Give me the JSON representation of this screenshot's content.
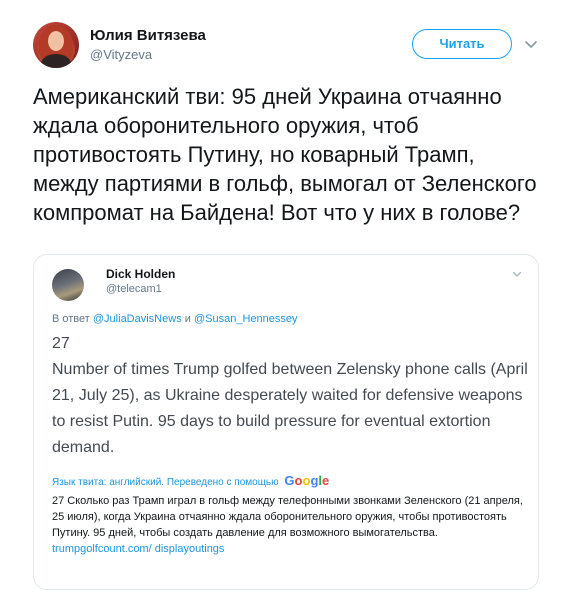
{
  "author": {
    "name": "Юлия Витязева",
    "handle": "@Vityzeva"
  },
  "follow_button": {
    "label": "Читать"
  },
  "icons": {
    "menu": "chevron-down-icon"
  },
  "tweet": {
    "text": "Американский тви: 95 дней Украина отчаянно ждала оборонительного оружия, чтоб противостоять Путину, но коварный Трамп, между партиями в гольф, вымогал от Зеленского компромат на Байдена! Вот что у них в голове?"
  },
  "quoted_tweet": {
    "name": "Dick Holden",
    "handle": "@telecam1",
    "reply_prefix": "В ответ",
    "reply_user_1": "@JuliaDavisNews",
    "reply_and": "и",
    "reply_user_2": "@Susan_Hennessey",
    "text_line_1": "27",
    "text_line_2": "Number of times Trump golfed between Zelensky phone calls (April 21, July 25), as Ukraine desperately waited for defensive weapons to resist Putin. 95 days to build pressure for eventual extortion demand.",
    "translated_from": "Язык твита: английский. Переведено с помощью",
    "translator_logo": "Google",
    "translation_text": "27 Сколько раз Трамп играл в гольф между телефонными звонками Зеленского (21 апреля, 25 июля), когда Украина отчаянно ждала оборонительного оружия, чтобы противостоять Путину. 95 дней, чтобы создать давление для возможного вымогательства.",
    "translation_link": "trumpgolfcount.com/ displayoutings"
  },
  "colors": {
    "accent": "#1da1f2",
    "link": "#1b95e0",
    "text": "#14171a",
    "muted": "#657786",
    "border": "#e1e8ed"
  }
}
